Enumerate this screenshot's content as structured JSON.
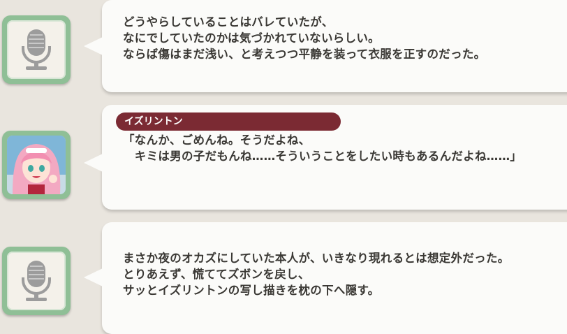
{
  "log_entries": [
    {
      "speaker": "",
      "avatar_icon": "microphone-icon",
      "text": "どうやらしていることはバレていたが、\nなにでしていたのかは気づかれていないらしい。\nならば傷はまだ浅い、と考えつつ平静を装って衣服を正すのだった。"
    },
    {
      "speaker": "イズリントン",
      "avatar_icon": "character-portrait",
      "text": "「なんか、ごめんね。そうだよね、\n　キミは男の子だもんね……そういうことをしたい時もあるんだよね……」"
    },
    {
      "speaker": "",
      "avatar_icon": "microphone-icon",
      "text": "まさか夜のオカズにしていた本人が、いきなり現れるとは想定外だった。\nとりあえず、慌ててズボンを戻し、\nサッとイズリントンの写し描きを枕の下へ隠す。"
    }
  ],
  "colors": {
    "background": "#e9e5de",
    "bubble": "#fbfbf9",
    "name_tag": "#7b2a33",
    "avatar_frame": "#8fbf96",
    "text": "#3a3834"
  }
}
